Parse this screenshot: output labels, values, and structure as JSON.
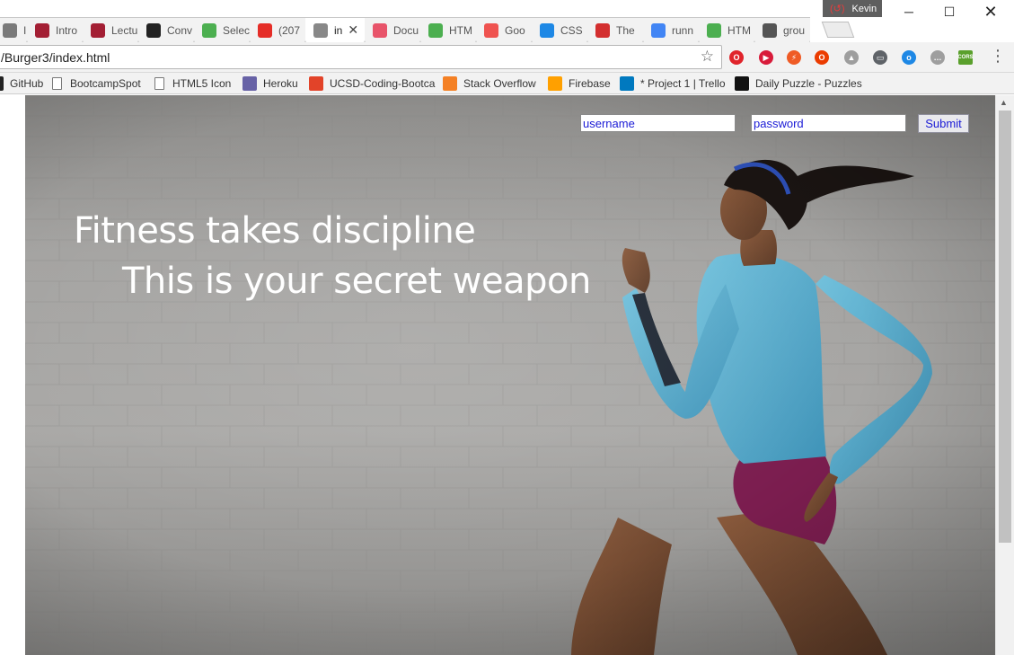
{
  "browser": {
    "tabs": [
      {
        "label": "Indi",
        "favicon": "page-icon",
        "color": "#7a7a7a"
      },
      {
        "label": "Intro",
        "favicon": "mit-ocw-icon",
        "color": "#a31f34"
      },
      {
        "label": "Lectu",
        "favicon": "mit-ocw-icon",
        "color": "#a31f34"
      },
      {
        "label": "Conv",
        "favicon": "github-icon",
        "color": "#222222"
      },
      {
        "label": "Selec",
        "favicon": "checkbox-icon",
        "color": "#4caf50"
      },
      {
        "label": "(207",
        "favicon": "youtube-icon",
        "color": "#e52d27"
      },
      {
        "label": "in",
        "favicon": "page-icon",
        "color": "#888888",
        "active": true
      },
      {
        "label": "Docu",
        "favicon": "devdocs-icon",
        "color": "#e8546a"
      },
      {
        "label": "HTM",
        "favicon": "w3schools-icon",
        "color": "#4caf50"
      },
      {
        "label": "Goo",
        "favicon": "google-fonts-icon",
        "color": "#ef5350"
      },
      {
        "label": "CSS",
        "favicon": "css-icon",
        "color": "#1e88e5"
      },
      {
        "label": "The",
        "favicon": "pc-icon",
        "color": "#d32f2f"
      },
      {
        "label": "runn",
        "favicon": "google-icon",
        "color": "#4285f4"
      },
      {
        "label": "HTM",
        "favicon": "w3schools-icon",
        "color": "#4caf50"
      },
      {
        "label": "grou",
        "favicon": "hash-icon",
        "color": "#555555"
      }
    ],
    "profile_name": "Kevin",
    "url": "/Burger3/index.html",
    "bookmarks": [
      {
        "label": "GitHub",
        "icon": "github-icon",
        "color": "#222222"
      },
      {
        "label": "BootcampSpot",
        "icon": "page-icon",
        "color": "#777777"
      },
      {
        "label": "HTML5 Icon",
        "icon": "page-icon",
        "color": "#777777"
      },
      {
        "label": "Heroku",
        "icon": "heroku-icon",
        "color": "#6762a6"
      },
      {
        "label": "UCSD-Coding-Bootca",
        "icon": "gitlab-icon",
        "color": "#e24329"
      },
      {
        "label": "Stack Overflow",
        "icon": "stackoverflow-icon",
        "color": "#f48024"
      },
      {
        "label": "Firebase",
        "icon": "firebase-icon",
        "color": "#ffa000"
      },
      {
        "label": "* Project 1 | Trello",
        "icon": "trello-icon",
        "color": "#0079bf"
      },
      {
        "label": "Daily Puzzle - Puzzles",
        "icon": "nyt-icon",
        "color": "#111111"
      }
    ],
    "extensions": [
      {
        "name": "opera-icon",
        "color": "#e0242b",
        "glyph": "O"
      },
      {
        "name": "video-ext-icon",
        "color": "#d81b3a",
        "glyph": "▶"
      },
      {
        "name": "postman-icon",
        "color": "#ef5b25",
        "glyph": "⚡"
      },
      {
        "name": "office-icon",
        "color": "#eb3c00",
        "glyph": "O"
      },
      {
        "name": "drive-icon",
        "color": "#9e9e9e",
        "glyph": "▲"
      },
      {
        "name": "cast-icon",
        "color": "#5f6368",
        "glyph": "▭"
      },
      {
        "name": "ring-ext-icon",
        "color": "#1e88e5",
        "glyph": "o"
      },
      {
        "name": "dots-ext-icon",
        "color": "#9e9e9e",
        "glyph": "…"
      },
      {
        "name": "cors-icon",
        "color": "#5aa02c",
        "glyph": "CORS"
      }
    ]
  },
  "page": {
    "headline": "Fitness takes discipline",
    "subline": "This is your secret weapon",
    "username_placeholder": "username",
    "password_placeholder": "password",
    "submit_label": "Submit",
    "link_color": "#1a1ad6"
  }
}
